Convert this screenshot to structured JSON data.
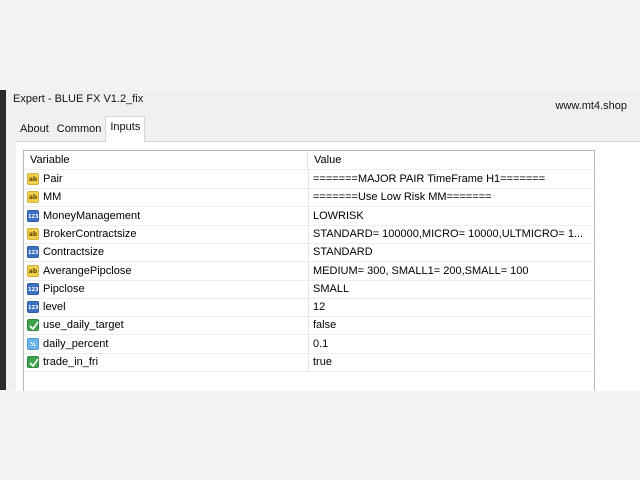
{
  "window": {
    "title": "Expert - BLUE FX V1.2_fix",
    "watermark": "www.mt4.shop"
  },
  "tabs": [
    {
      "label": "About",
      "active": false
    },
    {
      "label": "Common",
      "active": false
    },
    {
      "label": "Inputs",
      "active": true
    }
  ],
  "table": {
    "headers": {
      "variable": "Variable",
      "value": "Value"
    },
    "rows": [
      {
        "variable": "Pair",
        "value": "=======MAJOR PAIR TimeFrame H1=======",
        "icon": "string-ab-icon"
      },
      {
        "variable": "MM",
        "value": "=======Use Low Risk MM=======",
        "icon": "string-ab-icon"
      },
      {
        "variable": "MoneyManagement",
        "value": "LOWRISK",
        "icon": "integer-123-icon"
      },
      {
        "variable": "BrokerContractsize",
        "value": "STANDARD= 100000,MICRO= 10000,ULTMICRO= 1...",
        "icon": "string-ab-icon"
      },
      {
        "variable": "Contractsize",
        "value": "STANDARD",
        "icon": "integer-123-icon"
      },
      {
        "variable": "AverangePipclose",
        "value": "MEDIUM= 300,  SMALL1= 200,SMALL= 100",
        "icon": "string-ab-icon"
      },
      {
        "variable": "Pipclose",
        "value": "SMALL",
        "icon": "integer-123-icon"
      },
      {
        "variable": "level",
        "value": "12",
        "icon": "integer-123-icon"
      },
      {
        "variable": "use_daily_target",
        "value": "false",
        "icon": "boolean-icon"
      },
      {
        "variable": "daily_percent",
        "value": "0.1",
        "icon": "double-fraction-icon"
      },
      {
        "variable": "trade_in_fri",
        "value": "true",
        "icon": "boolean-icon"
      }
    ]
  },
  "colors": {
    "background": "#f3f4f6",
    "dialog": "#f0f0f0",
    "panel": "#ffffff",
    "grid_border": "#b9b9b9"
  }
}
